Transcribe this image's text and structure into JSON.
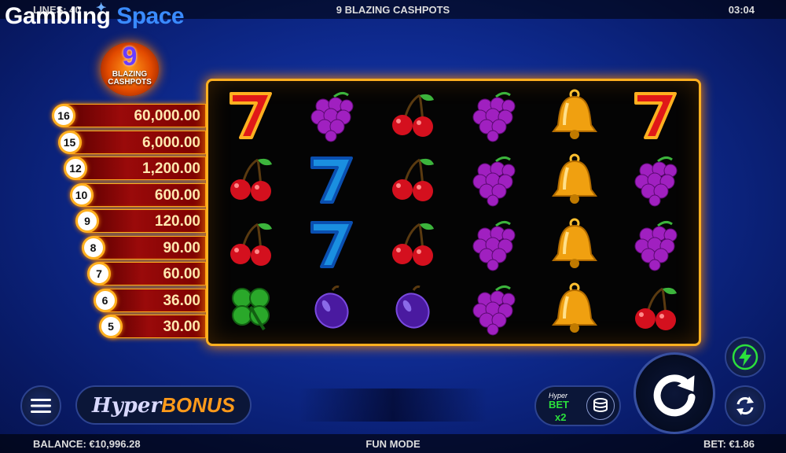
{
  "header": {
    "lines": "LINES: 40",
    "game_title": "9 BLAZING CASHPOTS",
    "clock": "03:04"
  },
  "watermark": {
    "word1": "Gambling",
    "word2": "Space"
  },
  "brand_badge": {
    "number": "9",
    "name_line1": "BLAZING",
    "name_line2": "CASHPOTS"
  },
  "paytable": [
    {
      "count": "16",
      "value": "60,000.00"
    },
    {
      "count": "15",
      "value": "6,000.00"
    },
    {
      "count": "12",
      "value": "1,200.00"
    },
    {
      "count": "10",
      "value": "600.00"
    },
    {
      "count": "9",
      "value": "120.00"
    },
    {
      "count": "8",
      "value": "90.00"
    },
    {
      "count": "7",
      "value": "60.00"
    },
    {
      "count": "6",
      "value": "36.00"
    },
    {
      "count": "5",
      "value": "30.00"
    }
  ],
  "reels": [
    [
      "red-seven-icon",
      "cherry-icon",
      "cherry-icon",
      "clover-icon"
    ],
    [
      "grapes-icon",
      "blue-seven-icon",
      "blue-seven-icon",
      "plum-icon"
    ],
    [
      "cherry-icon",
      "cherry-icon",
      "cherry-icon",
      "plum-icon"
    ],
    [
      "grapes-icon",
      "grapes-icon",
      "grapes-icon",
      "grapes-icon"
    ],
    [
      "bell-icon",
      "bell-icon",
      "bell-icon",
      "bell-icon"
    ],
    [
      "red-seven-icon",
      "grapes-icon",
      "grapes-icon",
      "cherry-icon"
    ]
  ],
  "controls": {
    "hyper_bonus_word1": "Hyper",
    "hyper_bonus_word2": "BONUS",
    "hyperbet_word1": "Hyper",
    "hyperbet_word2": "BET",
    "hyperbet_multiplier": "x2"
  },
  "footer": {
    "balance": "BALANCE: €10,996.28",
    "mode": "FUN MODE",
    "bet": "BET: €1.86"
  },
  "colors": {
    "frame_gold": "#ffb020",
    "paytable_red": "#9a0a0a",
    "turbo_green": "#2be03c"
  }
}
